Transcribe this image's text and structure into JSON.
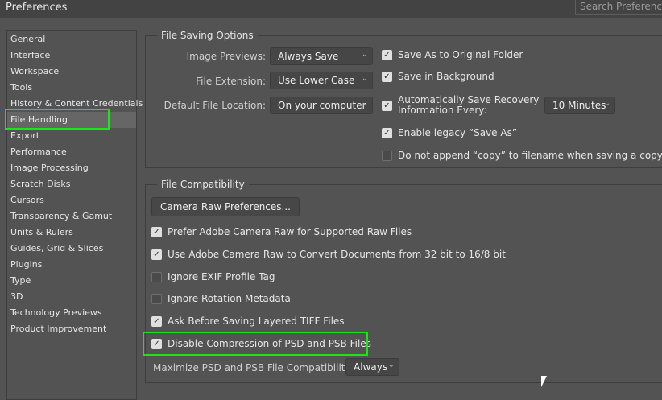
{
  "title": "Preferences",
  "search_placeholder": "Search Preferences",
  "sidebar": [
    "General",
    "Interface",
    "Workspace",
    "Tools",
    "History & Content Credentials",
    "File Handling",
    "Export",
    "Performance",
    "Image Processing",
    "Scratch Disks",
    "Cursors",
    "Transparency & Gamut",
    "Units & Rulers",
    "Guides, Grid & Slices",
    "Plugins",
    "Type",
    "3D",
    "Technology Previews",
    "Product Improvement"
  ],
  "selected": "File Handling",
  "highlight_color": "#19e619",
  "saving": {
    "title": "File Saving Options",
    "image_previews_label": "Image Previews:",
    "image_previews": "Always Save",
    "file_extension_label": "File Extension:",
    "file_extension": "Use Lower Case",
    "location_label": "Default File Location:",
    "location": "On your computer",
    "save_original": "Save As to Original Folder",
    "save_background": "Save in Background",
    "auto_save_1": "Automatically Save Recovery",
    "auto_save_2": "Information Every:",
    "auto_save_interval": "10 Minutes",
    "legacy": "Enable legacy “Save As”",
    "no_copy": "Do not append “copy” to filename when saving a copy"
  },
  "compat": {
    "title": "File Compatibility",
    "camera_raw_btn": "Camera Raw Preferences...",
    "prefer_acr": "Prefer Adobe Camera Raw for Supported Raw Files",
    "use_acr": "Use Adobe Camera Raw to Convert Documents from 32 bit to 16/8 bit",
    "ignore_exif": "Ignore EXIF Profile Tag",
    "ignore_rotation": "Ignore Rotation Metadata",
    "ask_tiff": "Ask Before Saving Layered TIFF Files",
    "disable_compression": "Disable Compression of PSD and PSB Files",
    "maximize_label": "Maximize PSD and PSB File Compatibility:",
    "maximize": "Always"
  }
}
